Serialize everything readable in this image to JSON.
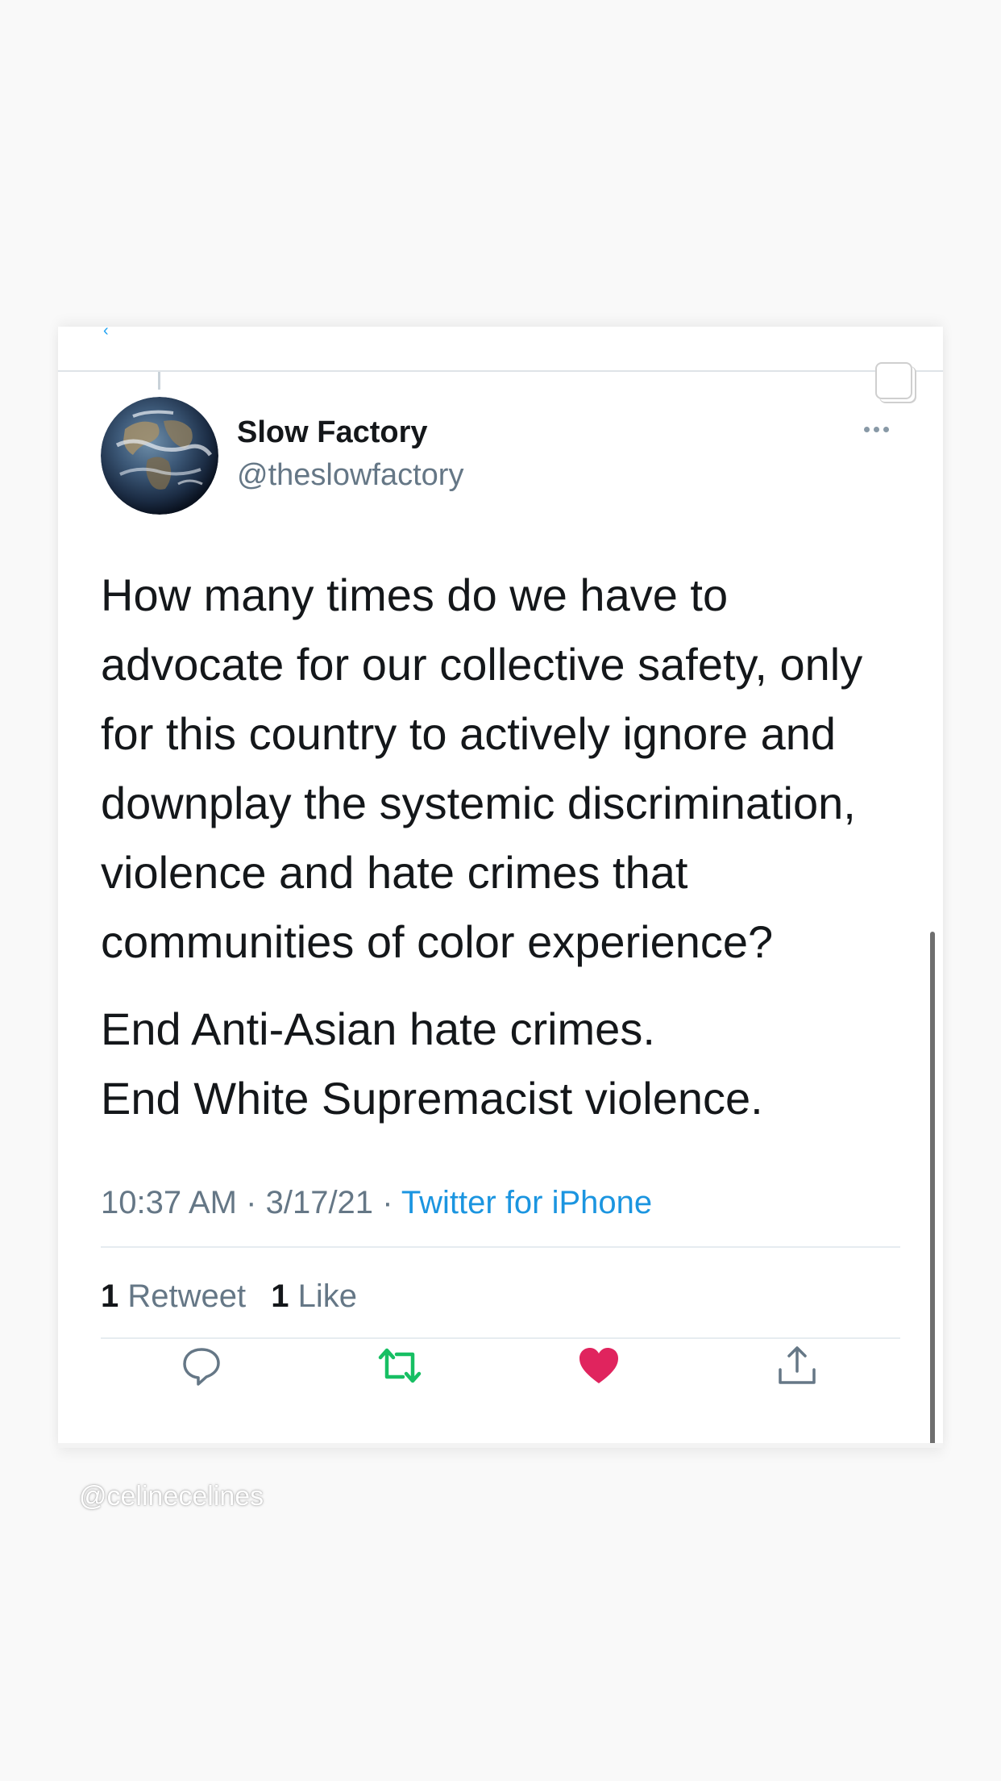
{
  "tweet": {
    "display_name": "Slow Factory",
    "handle": "@theslowfactory",
    "paragraphs": [
      "How many times do we have to advocate for our collective safety, only for this country to actively ignore and downplay the systemic discrimination, violence and hate crimes that communities of color experience?",
      "End Anti-Asian hate crimes.\nEnd White Supremacist violence."
    ],
    "time": "10:37 AM",
    "date": "3/17/21",
    "separator": "·",
    "source": "Twitter for iPhone",
    "retweet_count": "1",
    "retweet_label": "Retweet",
    "like_count": "1",
    "like_label": "Like"
  },
  "actions": {
    "reply_icon": "speech-bubble-icon",
    "retweet_icon": "retweet-arrows-icon",
    "like_icon": "heart-icon",
    "share_icon": "share-upload-icon"
  },
  "watermark": "@celinecelines",
  "colors": {
    "link_blue": "#1b95e0",
    "retweet_green": "#17bf63",
    "like_red": "#e0245e",
    "muted_gray": "#657786",
    "text_dark": "#14171a"
  }
}
